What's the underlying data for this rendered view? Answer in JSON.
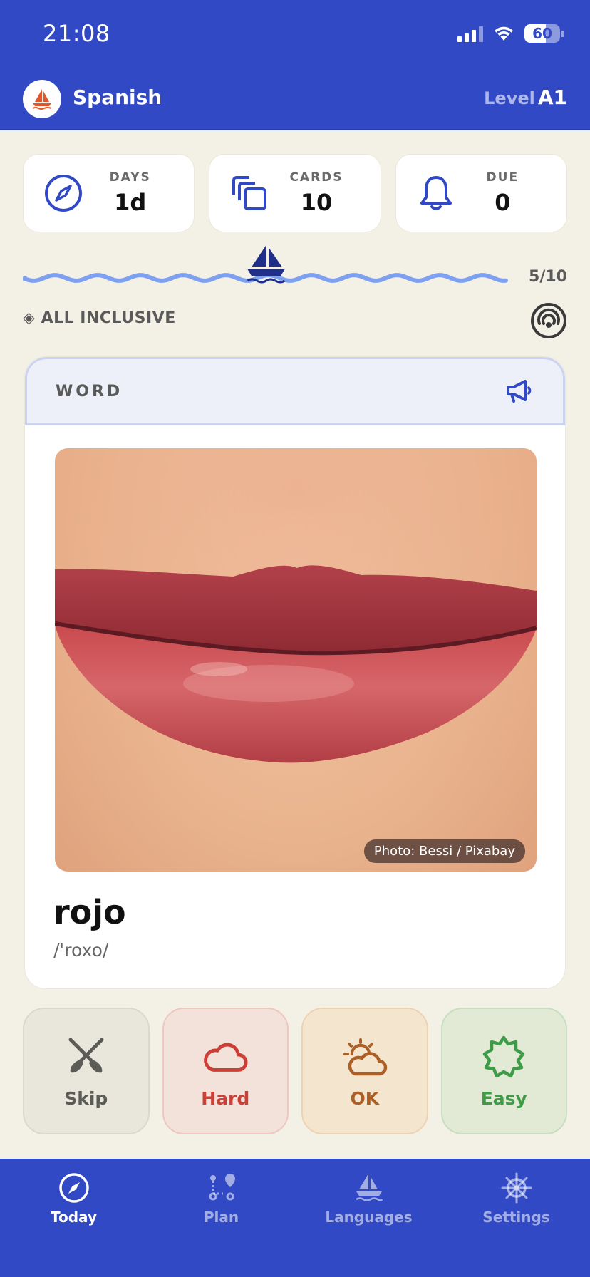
{
  "status_bar": {
    "time": "21:08",
    "battery": "60"
  },
  "header": {
    "app_title": "Spanish",
    "level_label": "Level",
    "level_value": "A1"
  },
  "stats": [
    {
      "label": "DAYS",
      "value": "1d",
      "icon": "compass-icon"
    },
    {
      "label": "CARDS",
      "value": "10",
      "icon": "cards-icon"
    },
    {
      "label": "DUE",
      "value": "0",
      "icon": "bell-icon"
    }
  ],
  "progress": {
    "count_text": "5/10",
    "fraction": 0.5
  },
  "deck": {
    "name": "◈ ALL INCLUSIVE"
  },
  "card": {
    "kind": "WORD",
    "photo_credit": "Photo: Bessi / Pixabay",
    "word": "rojo",
    "ipa": "/ˈroxo/"
  },
  "ratings": {
    "skip": "Skip",
    "hard": "Hard",
    "ok": "OK",
    "easy": "Easy"
  },
  "tabs": {
    "today": "Today",
    "plan": "Plan",
    "languages": "Languages",
    "settings": "Settings"
  },
  "colors": {
    "brand_blue": "#3149C4",
    "background": "#F3F0E6",
    "hard": "#CB3F36",
    "ok": "#AC5F27",
    "easy": "#3E9C48",
    "skip": "#5c5c57"
  }
}
